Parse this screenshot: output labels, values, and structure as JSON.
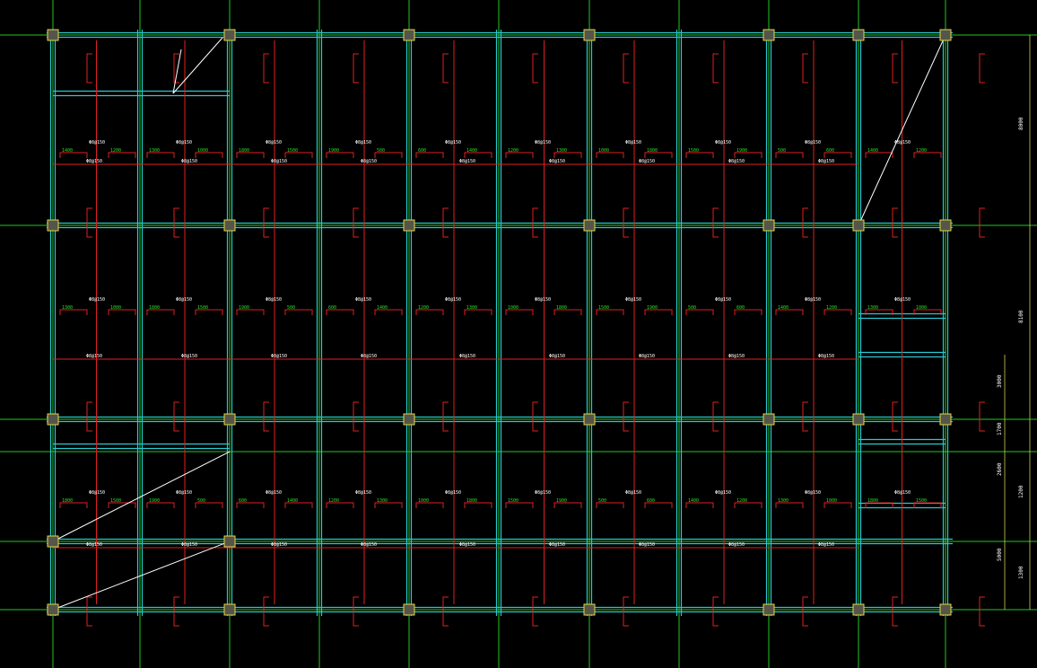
{
  "drawing": {
    "background": "#000000",
    "colors": {
      "grid": "#21c721",
      "beam": "#28c8d2",
      "rebar": "#e02020",
      "column_fill": "#56554a",
      "column_edge": "#e2d34a",
      "text_green": "#24e024",
      "text_white": "#ffffff"
    },
    "rebar_labels": [
      "1400",
      "1200",
      "1300",
      "1000",
      "1800",
      "1500",
      "1900",
      "500",
      "600"
    ],
    "slab_label": "Φ8@150",
    "dimensions": {
      "right_major": [
        "8000",
        "8100",
        "1200",
        "1300"
      ],
      "right_minor": [
        "3000",
        "1700",
        "2600",
        "5000"
      ]
    }
  }
}
